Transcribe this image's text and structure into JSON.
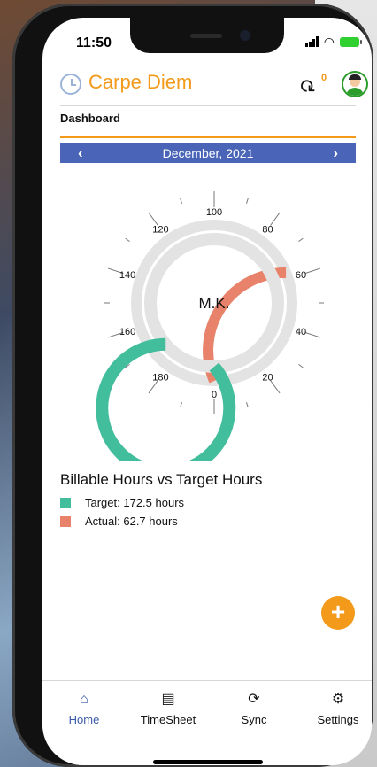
{
  "status": {
    "time": "11:50"
  },
  "header": {
    "title": "Carpe Diem",
    "sync_count": "0"
  },
  "page": {
    "title": "Dashboard"
  },
  "month_nav": {
    "prev": "‹",
    "label": "December, 2021",
    "next": "›"
  },
  "gauge": {
    "center_label": "M.K.",
    "max": 200,
    "target": 172.5,
    "actual": 62.7,
    "ticks": [
      "0",
      "20",
      "40",
      "60",
      "80",
      "100",
      "120",
      "140",
      "160",
      "180"
    ],
    "colors": {
      "target": "#43be9c",
      "actual": "#e8826a",
      "track": "#e3e3e3"
    }
  },
  "legend": {
    "title": "Billable Hours vs Target Hours",
    "items": [
      {
        "label": "Target: 172.5 hours",
        "color": "#43be9c"
      },
      {
        "label": "Actual: 62.7 hours",
        "color": "#e8826a"
      }
    ]
  },
  "fab": {
    "label": "+"
  },
  "tabs": [
    {
      "label": "Home",
      "icon": "home-icon"
    },
    {
      "label": "TimeSheet",
      "icon": "document-icon"
    },
    {
      "label": "Sync",
      "icon": "sync-icon"
    },
    {
      "label": "Settings",
      "icon": "gear-icon"
    }
  ]
}
